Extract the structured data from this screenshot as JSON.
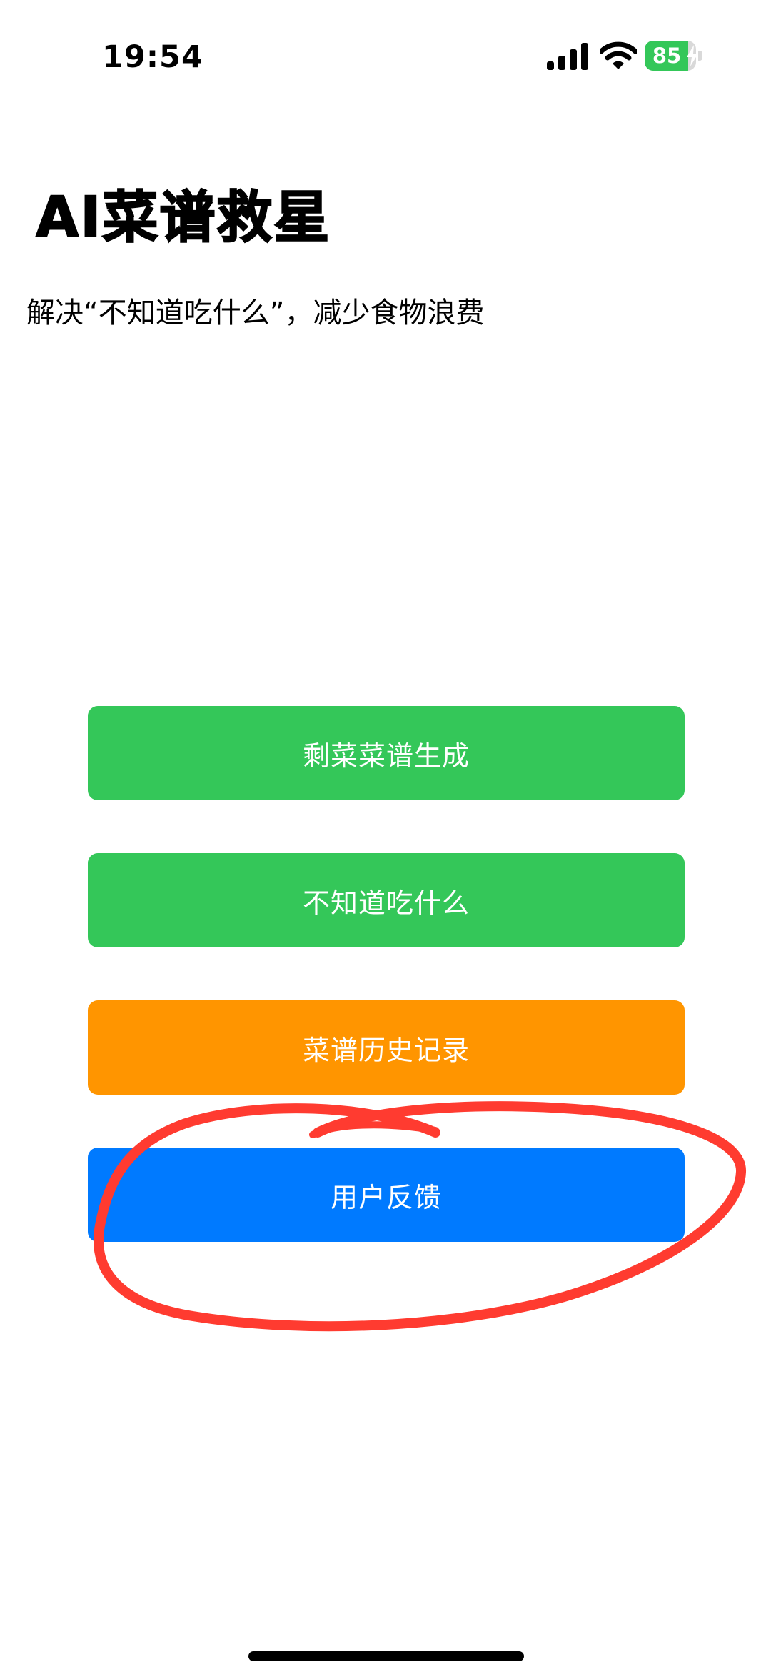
{
  "status_bar": {
    "time": "19:54",
    "signal_icon": "cellular-signal-icon",
    "wifi_icon": "wifi-icon",
    "battery_percent": 85,
    "battery_label": "85",
    "battery_charging": true,
    "battery_color": "#34c759"
  },
  "header": {
    "title": "AI菜谱救星",
    "subtitle": "解决“不知道吃什么”，减少食物浪费"
  },
  "buttons": [
    {
      "label": "剩菜菜谱生成",
      "color": "#34c759"
    },
    {
      "label": "不知道吃什么",
      "color": "#34c759"
    },
    {
      "label": "菜谱历史记录",
      "color": "#ff9500"
    },
    {
      "label": "用户反馈",
      "color": "#007aff"
    }
  ],
  "annotation": {
    "shape": "hand-drawn circle around 用户反馈 button",
    "color": "#ff3b30"
  }
}
